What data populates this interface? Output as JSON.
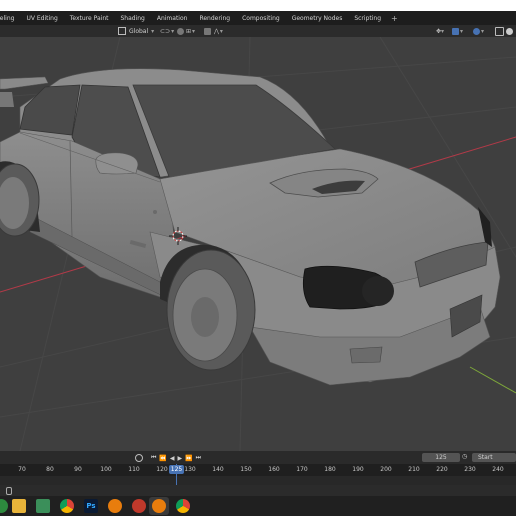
{
  "workspace_tabs": [
    "deling",
    "UV Editing",
    "Texture Paint",
    "Shading",
    "Animation",
    "Rendering",
    "Compositing",
    "Geometry Nodes",
    "Scripting"
  ],
  "add_tab_label": "+",
  "viewport_header": {
    "transform_orientation": "Global"
  },
  "timeline": {
    "current_frame": "125",
    "start_label": "Start",
    "ruler_labels": [
      "70",
      "80",
      "90",
      "100",
      "110",
      "120",
      "130",
      "140",
      "150",
      "160",
      "170",
      "180",
      "190",
      "200",
      "210",
      "220",
      "230",
      "240"
    ],
    "playhead_label": "125"
  },
  "taskbar_apps": [
    "file-explorer-icon",
    "app-icon",
    "chrome-icon",
    "photoshop-icon",
    "blender-icon",
    "app-red-icon",
    "blender-active-icon",
    "chrome-icon-2"
  ],
  "taskbar": {
    "ps_label": "Ps"
  },
  "colors": {
    "accent": "#4772b3",
    "viewport_bg": "#3f3f3f",
    "x_axis": "#b23a48",
    "y_axis": "#7ea83a"
  }
}
